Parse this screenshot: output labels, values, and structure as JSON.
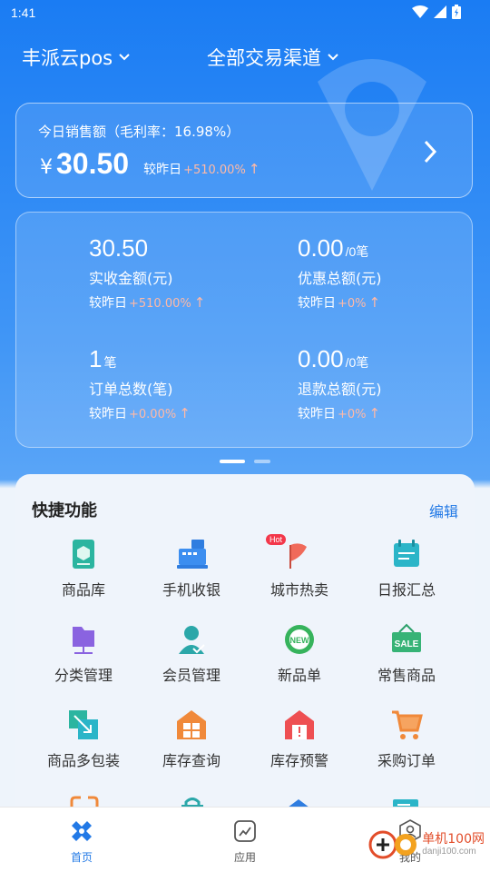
{
  "status_bar": {
    "time": "1:41"
  },
  "header": {
    "store": "丰派云pos",
    "channel": "全部交易渠道"
  },
  "sales": {
    "title": "今日销售额（毛利率：16.98%）",
    "currency": "¥",
    "amount": "30.50",
    "compare_label": "较昨日",
    "compare_pct": "+510.00%"
  },
  "stats": [
    {
      "value": "30.50",
      "unit": "",
      "label": "实收金额(元)",
      "compare_label": "较昨日",
      "compare_pct": "+510.00%"
    },
    {
      "value": "0.00",
      "unit": "/0笔",
      "label": "优惠总额(元)",
      "compare_label": "较昨日",
      "compare_pct": "+0%"
    },
    {
      "value": "1",
      "unit": "笔",
      "label": "订单总数(笔)",
      "compare_label": "较昨日",
      "compare_pct": "+0.00%"
    },
    {
      "value": "0.00",
      "unit": "/0笔",
      "label": "退款总额(元)",
      "compare_label": "较昨日",
      "compare_pct": "+0%"
    }
  ],
  "pager": {
    "pages": 2,
    "active": 1
  },
  "quick": {
    "title": "快捷功能",
    "edit": "编辑",
    "items": [
      {
        "label": "商品库",
        "icon": "product-library-icon"
      },
      {
        "label": "手机收银",
        "icon": "cash-register-icon"
      },
      {
        "label": "城市热卖",
        "icon": "hot-flag-icon",
        "badge": "Hot"
      },
      {
        "label": "日报汇总",
        "icon": "calendar-report-icon"
      },
      {
        "label": "分类管理",
        "icon": "folder-category-icon"
      },
      {
        "label": "会员管理",
        "icon": "member-icon"
      },
      {
        "label": "新品单",
        "icon": "new-badge-icon"
      },
      {
        "label": "常售商品",
        "icon": "sale-tag-icon"
      },
      {
        "label": "商品多包装",
        "icon": "multi-package-icon"
      },
      {
        "label": "库存查询",
        "icon": "stock-query-icon"
      },
      {
        "label": "库存预警",
        "icon": "stock-alert-icon"
      },
      {
        "label": "采购订单",
        "icon": "purchase-cart-icon"
      }
    ]
  },
  "nav": {
    "items": [
      {
        "label": "首页",
        "active": true
      },
      {
        "label": "应用",
        "active": false
      },
      {
        "label": "我的",
        "active": false
      }
    ]
  },
  "watermark": {
    "text": "单机100网",
    "sub": "danji100.com"
  },
  "colors": {
    "primary": "#1a7cf3",
    "accent_pct": "#ffb9a6",
    "link": "#2279e6"
  }
}
